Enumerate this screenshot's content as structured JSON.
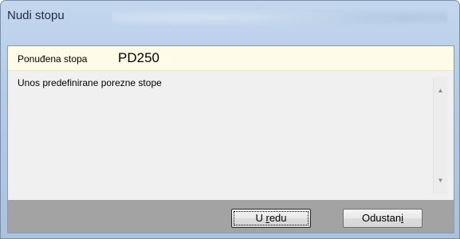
{
  "window": {
    "title": "Nudi stopu"
  },
  "form": {
    "field_label": "Ponuđena stopa",
    "field_value": "PD250",
    "description": "Unos predefinirane porezne stope"
  },
  "buttons": {
    "ok_label_pre": "U ",
    "ok_label_accel": "r",
    "ok_label_post": "edu",
    "cancel_label_pre": "Odustan",
    "cancel_label_accel": "i",
    "cancel_label_post": ""
  },
  "icons": {
    "scroll_up": "scroll-up-arrow-icon",
    "scroll_down": "scroll-down-arrow-icon"
  },
  "colors": {
    "title_bar": "#b4cbe6",
    "field_background": "#fefbe6",
    "memo_background": "#f0f0f0",
    "button_bar": "#a3a3a3"
  }
}
